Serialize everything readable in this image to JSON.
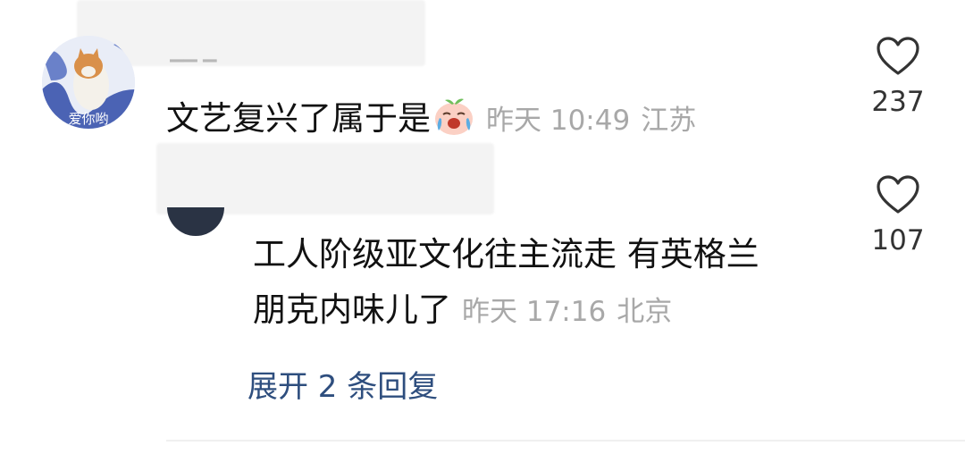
{
  "comments": [
    {
      "text": "文艺复兴了属于是",
      "emoji": "crying-laughing-peach-emoji",
      "time": "昨天 10:49",
      "location": "江苏",
      "likes": "237"
    },
    {
      "text_line1": "工人阶级亚文化往主流走 有英格兰",
      "text_line2": "朋克内味儿了",
      "time": "昨天 17:16",
      "location": "北京",
      "likes": "107"
    }
  ],
  "expand_replies_label": "展开 2 条回复",
  "colors": {
    "text": "#111111",
    "meta": "#a8a8a8",
    "link": "#2e4e7e",
    "icon": "#333333"
  },
  "icons": [
    "heart-outline-icon"
  ]
}
